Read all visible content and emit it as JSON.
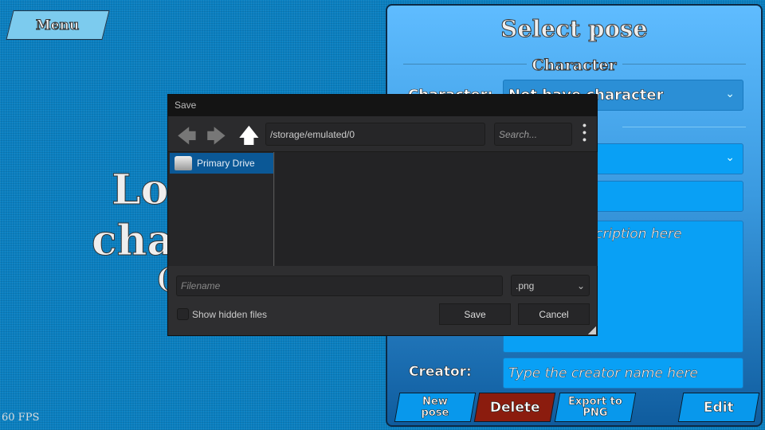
{
  "menu": {
    "label": "Menu"
  },
  "background_text": {
    "line1": "Lo",
    "line2": "cha",
    "line3": "("
  },
  "fps": "60 FPS",
  "panel": {
    "title": "Select pose",
    "section_character": "Character",
    "character_label": "Character:",
    "character_value": "Not have character",
    "description_placeholder": "Type the description here",
    "creator_label": "Creator:",
    "creator_placeholder": "Type the creator name here",
    "buttons": {
      "new_pose": "New pose",
      "delete": "Delete",
      "export": "Export to PNG",
      "edit": "Edit"
    },
    "colors": {
      "delete": "#8b1c0e",
      "button": "#0898ec"
    }
  },
  "dialog": {
    "title": "Save",
    "path": "/storage/emulated/0",
    "search_placeholder": "Search...",
    "drives": [
      {
        "label": "Primary Drive",
        "selected": true
      }
    ],
    "filename_placeholder": "Filename",
    "filetype": ".png",
    "show_hidden_label": "Show hidden files",
    "show_hidden_checked": false,
    "save": "Save",
    "cancel": "Cancel",
    "accent": "#0b5896"
  }
}
